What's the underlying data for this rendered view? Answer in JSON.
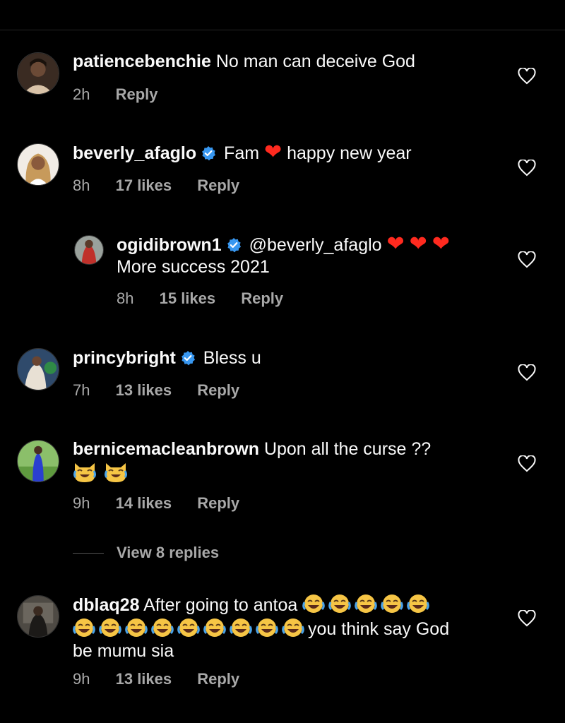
{
  "comments": [
    {
      "username": "patiencebenchie",
      "text": "No man can deceive God",
      "time": "2h",
      "reply": "Reply"
    },
    {
      "username": "beverly_afaglo",
      "text_pre": "Fam",
      "text_post": "happy new year",
      "time": "8h",
      "likes": "17 likes",
      "reply": "Reply"
    },
    {
      "username": "ogidibrown1",
      "mention": "@beverly_afaglo",
      "text_line2": "More success 2021",
      "time": "8h",
      "likes": "15 likes",
      "reply": "Reply"
    },
    {
      "username": "princybright",
      "text": "Bless u",
      "time": "7h",
      "likes": "13 likes",
      "reply": "Reply"
    },
    {
      "username": "bernicemacleanbrown",
      "text": "Upon all the curse ??",
      "time": "9h",
      "likes": "14 likes",
      "reply": "Reply"
    },
    {
      "username": "dblaq28",
      "text_pre": "After going to antoa",
      "text_mid": "you think say God",
      "text_line3": "be mumu sia",
      "time": "9h",
      "likes": "13 likes",
      "reply": "Reply"
    }
  ],
  "view_replies": "View 8 replies",
  "colors": {
    "background": "#000000",
    "text": "#fafafa",
    "meta": "#a8a8a8",
    "verified": "#3897f0",
    "heart_emoji": "#ff2a1f"
  },
  "icons": {
    "like": "heart-outline-icon",
    "verified": "verified-badge-icon",
    "laugh": "tears-of-joy-emoji",
    "cat": "cat-tears-of-joy-emoji"
  }
}
